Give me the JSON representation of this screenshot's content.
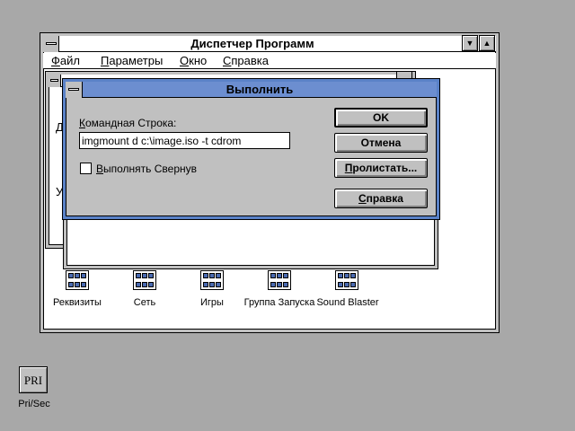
{
  "program_manager": {
    "title": "Диспетчер Программ",
    "minimize_glyph": "▼",
    "maximize_glyph": "▲",
    "menu": [
      {
        "first": "Ф",
        "rest": "айл"
      },
      {
        "first": "П",
        "rest": "араметры"
      },
      {
        "first": "О",
        "rest": "кно"
      },
      {
        "first": "С",
        "rest": "правка"
      }
    ]
  },
  "background": {
    "clipped_left_1": "Д",
    "clipped_left_2": "У"
  },
  "groups": [
    {
      "label": "Реквизиты",
      "icon": "group-icon"
    },
    {
      "label": "Сеть",
      "icon": "group-icon"
    },
    {
      "label": "Игры",
      "icon": "group-icon"
    },
    {
      "label": "Группа Запуска",
      "icon": "group-icon"
    },
    {
      "label": "Sound Blaster",
      "icon": "group-icon"
    }
  ],
  "run_dialog": {
    "title": "Выполнить",
    "command_label_first": "К",
    "command_label_rest": "омандная Строка:",
    "command_value": "imgmount d c:\\image.iso -t cdrom",
    "checkbox_first": "В",
    "checkbox_rest": "ыполнять Свернув",
    "checkbox_checked": false,
    "buttons": {
      "ok": "OK",
      "cancel": "Отмена",
      "browse_first": "П",
      "browse_rest": "ролистать...",
      "help_first": "С",
      "help_rest": "правка"
    }
  },
  "desktop": {
    "pri_icon_text": "PRI",
    "pri_label": "Pri/Sec"
  },
  "colors": {
    "desktop": "#a8a8a8",
    "dialog_title": "#6c8ed0",
    "face": "#c0c0c0"
  }
}
